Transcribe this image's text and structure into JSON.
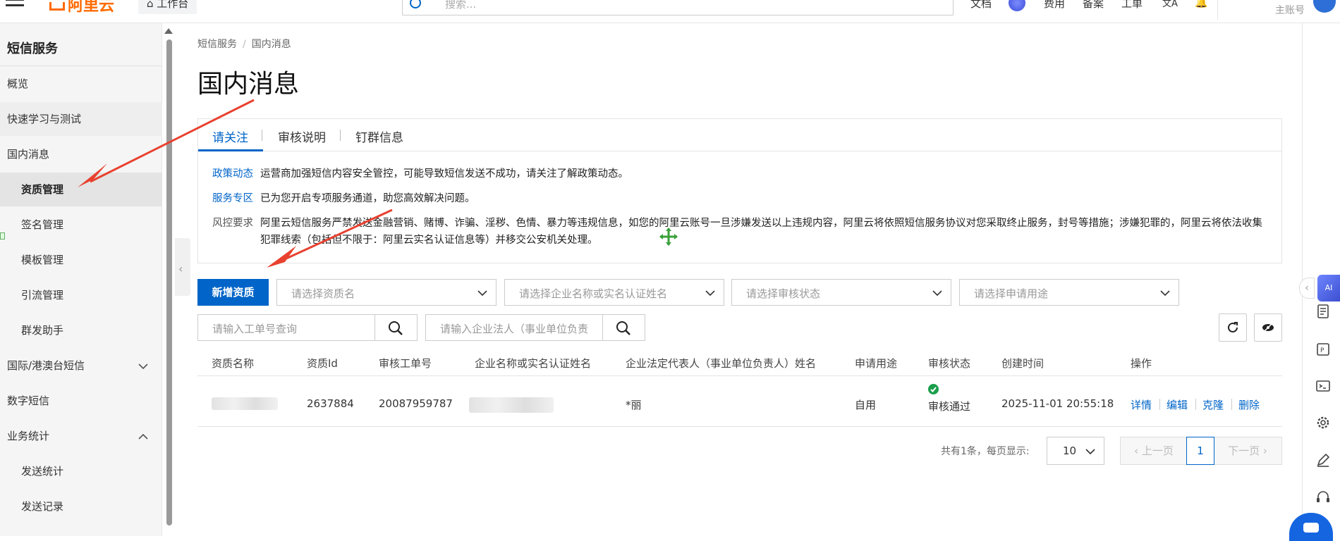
{
  "topbar": {
    "logo": "阿里云",
    "workspace": "工作台",
    "search_placeholder": "搜索...",
    "links": [
      "文档",
      "费用",
      "备案",
      "工单"
    ],
    "account": "主账号"
  },
  "sidebar": {
    "title": "短信服务",
    "items": [
      {
        "label": "概览"
      },
      {
        "label": "快速学习与测试"
      },
      {
        "label": "国内消息"
      },
      {
        "label": "资质管理"
      },
      {
        "label": "签名管理"
      },
      {
        "label": "模板管理"
      },
      {
        "label": "引流管理"
      },
      {
        "label": "群发助手"
      },
      {
        "label": "国际/港澳台短信"
      },
      {
        "label": "数字短信"
      },
      {
        "label": "业务统计"
      },
      {
        "label": "发送统计"
      },
      {
        "label": "发送记录"
      }
    ]
  },
  "breadcrumb": {
    "root": "短信服务",
    "current": "国内消息"
  },
  "page_title": "国内消息",
  "notice": {
    "tabs": [
      "请关注",
      "审核说明",
      "钉群信息"
    ],
    "rows": [
      {
        "key": "政策动态",
        "text": "运营商加强短信内容安全管控，可能导致短信发送不成功，请关注了解政策动态。"
      },
      {
        "key": "服务专区",
        "text": "已为您开启专项服务通道，助您高效解决问题。"
      },
      {
        "key": "风控要求",
        "text": "阿里云短信服务严禁发送金融营销、赌博、诈骗、淫秽、色情、暴力等违规信息，如您的阿里云账号一旦涉嫌发送以上违规内容，阿里云将依照短信服务协议对您采取终止服务，封号等措施；涉嫌犯罪的，阿里云将依法收集犯罪线索（包括但不限于：阿里云实名认证信息等）并移交公安机关处理。"
      }
    ]
  },
  "filters": {
    "add_button": "新增资质",
    "selects": [
      "请选择资质名",
      "请选择企业名称或实名认证姓名",
      "请选择审核状态",
      "请选择申请用途"
    ],
    "search1_placeholder": "请输入工单号查询",
    "search2_placeholder": "请输入企业法人（事业单位负责"
  },
  "table": {
    "columns": [
      "资质名称",
      "资质Id",
      "审核工单号",
      "企业名称或实名认证姓名",
      "企业法定代表人（事业单位负责人）姓名",
      "申请用途",
      "审核状态",
      "创建时间",
      "操作"
    ],
    "rows": [
      {
        "id": "2637884",
        "ticket": "20087959787",
        "legal_rep": "*丽",
        "usage": "自用",
        "status": "审核通过",
        "created": "2025-11-01 20:55:18",
        "actions": [
          "详情",
          "编辑",
          "克隆",
          "删除"
        ]
      }
    ]
  },
  "pagination": {
    "summary": "共有1条，每页显示:",
    "page_size": "10",
    "prev": "上一页",
    "current": "1",
    "next": "下一页"
  },
  "colors": {
    "primary": "#0064c8",
    "brand": "#ff6a00",
    "success": "#1a9e4b",
    "arrow": "#e8412f"
  }
}
